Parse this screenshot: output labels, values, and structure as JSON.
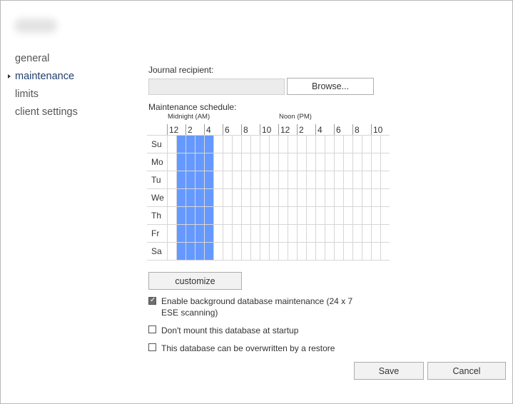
{
  "dialog": {
    "title_blurred": true
  },
  "nav": {
    "items": [
      {
        "label": "general",
        "active": false
      },
      {
        "label": "maintenance",
        "active": true
      },
      {
        "label": "limits",
        "active": false
      },
      {
        "label": "client settings",
        "active": false
      }
    ]
  },
  "journal": {
    "label": "Journal recipient:",
    "value": "",
    "browse_label": "Browse..."
  },
  "schedule": {
    "label": "Maintenance schedule:",
    "midnight_label": "Midnight (AM)",
    "noon_label": "Noon (PM)",
    "hour_labels": [
      "12",
      "2",
      "4",
      "6",
      "8",
      "10",
      "12",
      "2",
      "4",
      "6",
      "8",
      "10"
    ],
    "days": [
      "Su",
      "Mo",
      "Tu",
      "We",
      "Th",
      "Fr",
      "Sa"
    ],
    "selected_half_hour_slots": [
      1,
      2,
      3,
      4
    ],
    "selected_color": "#6699ff",
    "customize_label": "customize"
  },
  "options": {
    "background_maintenance": {
      "label": "Enable background database maintenance (24 x 7 ESE scanning)",
      "line1": "Enable background database maintenance (24 x 7",
      "line2": "ESE scanning)",
      "checked": true
    },
    "dont_mount": {
      "label": "Don't mount this database at startup",
      "checked": false
    },
    "overwrite_restore": {
      "label": "This database can be overwritten by a restore",
      "checked": false
    }
  },
  "footer": {
    "save_label": "Save",
    "cancel_label": "Cancel"
  }
}
